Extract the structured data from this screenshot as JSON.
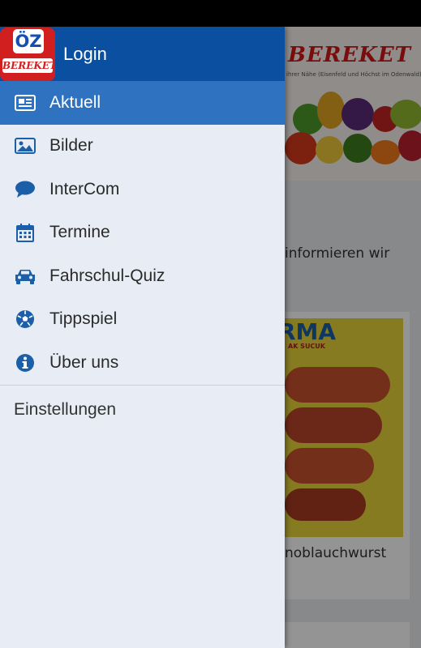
{
  "header": {
    "login_label": "Login",
    "logo_top": "ÖZ",
    "logo_bottom": "BEREKET"
  },
  "menu": {
    "items": [
      {
        "label": "Aktuell",
        "icon": "newspaper-icon",
        "active": true
      },
      {
        "label": "Bilder",
        "icon": "image-icon",
        "active": false
      },
      {
        "label": "InterCom",
        "icon": "chat-bubble-icon",
        "active": false
      },
      {
        "label": "Termine",
        "icon": "calendar-icon",
        "active": false
      },
      {
        "label": "Fahrschul-Quiz",
        "icon": "car-icon",
        "active": false
      },
      {
        "label": "Tippspiel",
        "icon": "soccer-ball-icon",
        "active": false
      },
      {
        "label": "Über uns",
        "icon": "info-icon",
        "active": false
      }
    ],
    "settings_label": "Einstellungen"
  },
  "background": {
    "banner_brand": "BEREKET",
    "banner_tagline": "ihrer Nähe (Eisenfeld und Höchst im Odenwald)",
    "intro_text_line1": "informieren wir",
    "intro_text_line2": "",
    "card_brand": "RMA",
    "card_sub": "AK SUCUK",
    "card_caption": "noblauchwurst"
  },
  "colors": {
    "header": "#0b4fa0",
    "active_item": "#2f73c0",
    "icon": "#1a5fa8",
    "drawer_bg": "#e8edf5"
  }
}
